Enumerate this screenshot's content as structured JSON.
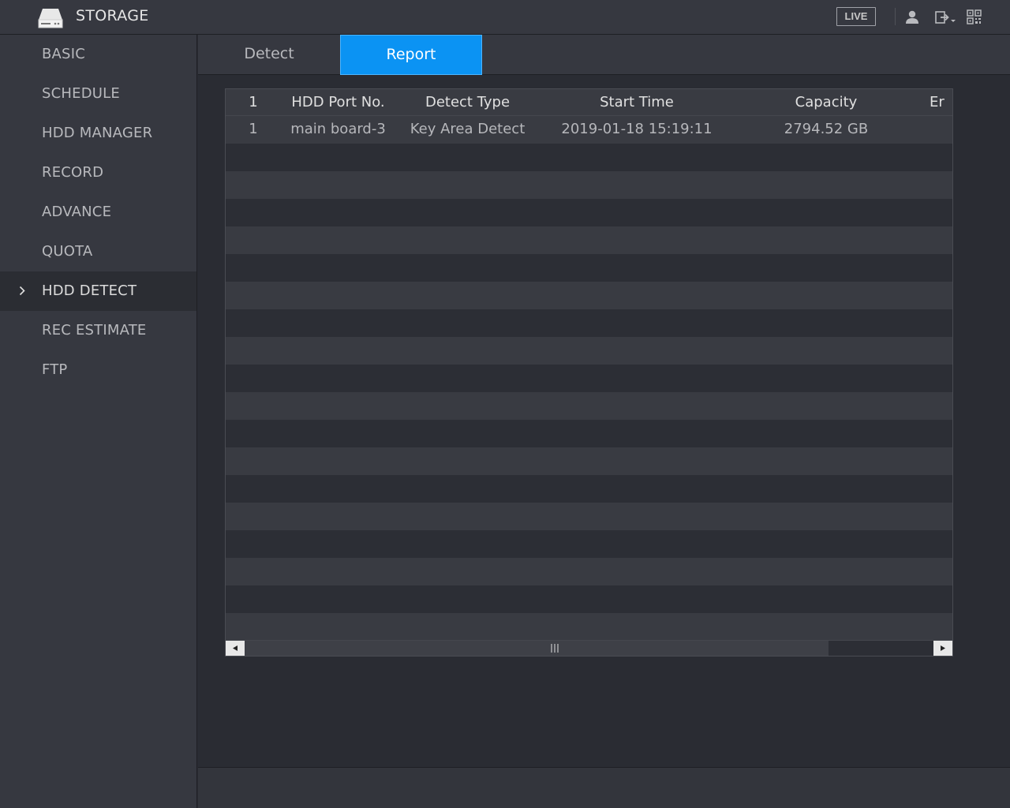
{
  "app": {
    "title": "STORAGE",
    "icon": "hdd-icon"
  },
  "topbar": {
    "live_label": "LIVE",
    "icons": [
      "user-icon",
      "logout-icon",
      "qr-code-icon"
    ]
  },
  "sidebar": {
    "items": [
      {
        "label": "BASIC",
        "active": false
      },
      {
        "label": "SCHEDULE",
        "active": false
      },
      {
        "label": "HDD MANAGER",
        "active": false
      },
      {
        "label": "RECORD",
        "active": false
      },
      {
        "label": "ADVANCE",
        "active": false
      },
      {
        "label": "QUOTA",
        "active": false
      },
      {
        "label": "HDD DETECT",
        "active": true
      },
      {
        "label": "REC ESTIMATE",
        "active": false
      },
      {
        "label": "FTP",
        "active": false
      }
    ]
  },
  "tabs": [
    {
      "label": "Detect",
      "active": false
    },
    {
      "label": "Report",
      "active": true
    }
  ],
  "table": {
    "columns": [
      "1",
      "HDD Port No.",
      "Detect Type",
      "Start Time",
      "Capacity",
      "Er"
    ],
    "rows": [
      [
        "1",
        "main board-3",
        "Key Area Detect",
        "2019-01-18 15:19:11",
        "2794.52 GB",
        ""
      ]
    ]
  },
  "colors": {
    "accent": "#0b93f3",
    "background": "#2a2c33",
    "panel": "#363840"
  }
}
